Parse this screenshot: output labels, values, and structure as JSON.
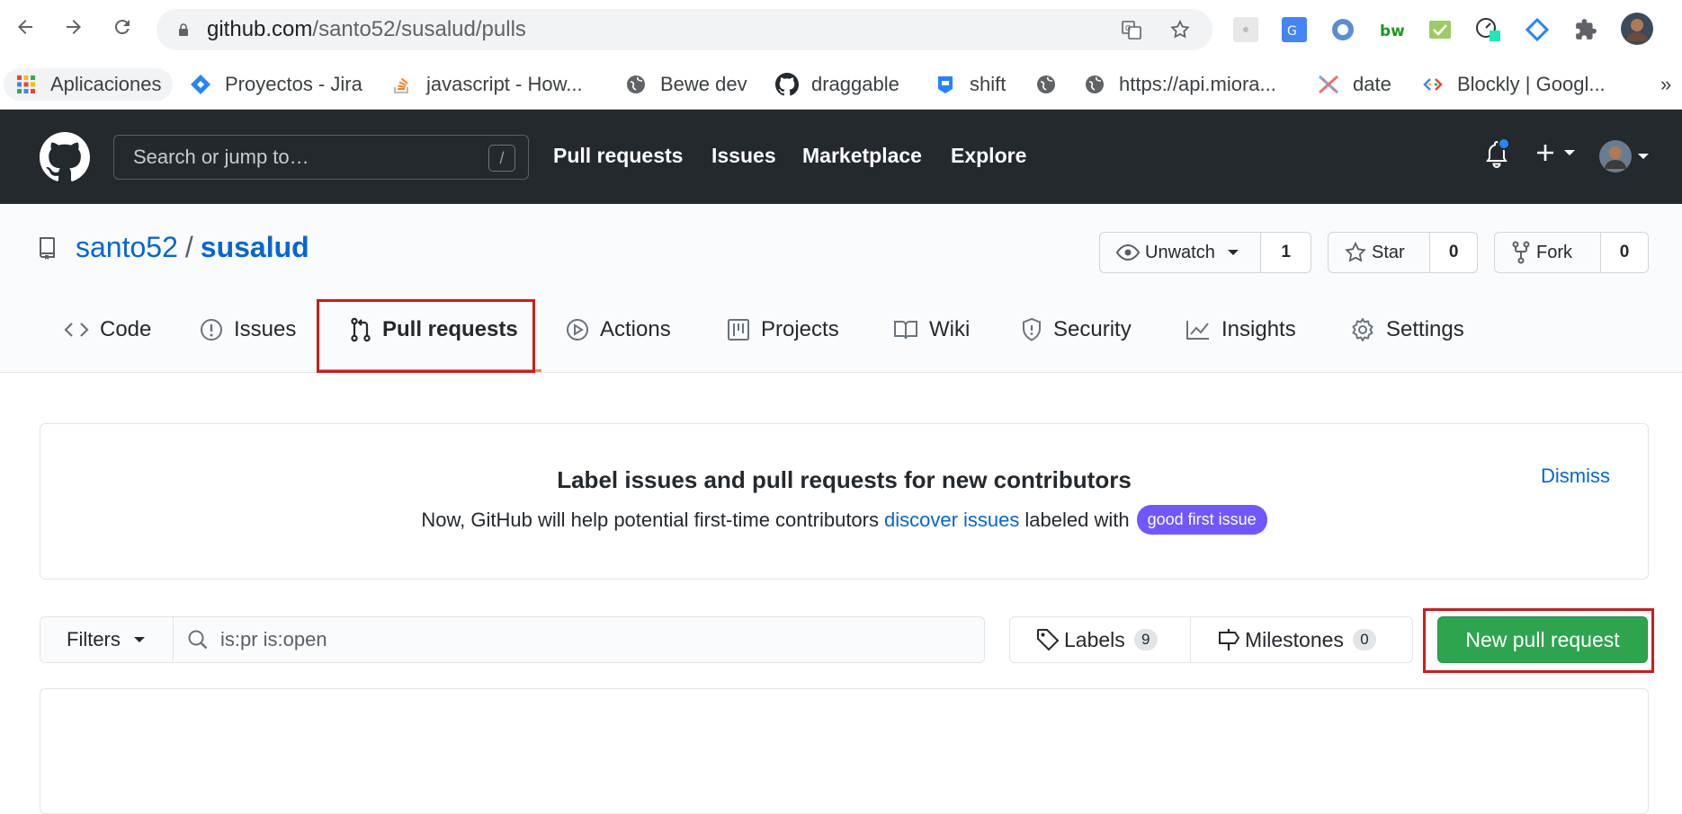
{
  "browser": {
    "url_host": "github.com",
    "url_path": "/santo52/susalud/pulls",
    "bookmarks": [
      {
        "label": "Aplicaciones",
        "icon": "apps-grid-icon"
      },
      {
        "label": "Proyectos - Jira",
        "icon": "jira-icon"
      },
      {
        "label": "javascript - How...",
        "icon": "stackoverflow-icon"
      },
      {
        "label": "Bewe dev",
        "icon": "globe-icon"
      },
      {
        "label": "draggable",
        "icon": "github-icon"
      },
      {
        "label": "shift",
        "icon": "shift-icon"
      },
      {
        "label": "",
        "icon": "globe-icon"
      },
      {
        "label": "https://api.miora...",
        "icon": "globe-icon"
      },
      {
        "label": "date",
        "icon": "date-icon"
      },
      {
        "label": "Blockly  |  Googl...",
        "icon": "blockly-icon"
      }
    ],
    "overflow": "»"
  },
  "gh_header": {
    "search_placeholder": "Search or jump to…",
    "search_shortcut": "/",
    "nav": [
      "Pull requests",
      "Issues",
      "Marketplace",
      "Explore"
    ]
  },
  "repo": {
    "owner": "santo52",
    "separator": "/",
    "name": "susalud",
    "unwatch_label": "Unwatch",
    "watch_count": "1",
    "star_label": "Star",
    "star_count": "0",
    "fork_label": "Fork",
    "fork_count": "0",
    "tabs": [
      {
        "label": "Code",
        "icon": "code-icon"
      },
      {
        "label": "Issues",
        "icon": "issue-opened-icon"
      },
      {
        "label": "Pull requests",
        "icon": "git-pull-request-icon",
        "active": true
      },
      {
        "label": "Actions",
        "icon": "play-icon"
      },
      {
        "label": "Projects",
        "icon": "project-icon"
      },
      {
        "label": "Wiki",
        "icon": "book-icon"
      },
      {
        "label": "Security",
        "icon": "shield-icon"
      },
      {
        "label": "Insights",
        "icon": "graph-icon"
      },
      {
        "label": "Settings",
        "icon": "gear-icon"
      }
    ]
  },
  "banner": {
    "title": "Label issues and pull requests for new contributors",
    "desc_before": "Now, GitHub will help potential first-time contributors",
    "desc_link": "discover issues",
    "desc_after": "labeled with",
    "label_name": "good first issue",
    "label_color": "#7057ff",
    "dismiss": "Dismiss"
  },
  "filters": {
    "filters_label": "Filters",
    "query": "is:pr is:open",
    "labels_label": "Labels",
    "labels_count": "9",
    "milestones_label": "Milestones",
    "milestones_count": "0",
    "new_pr_label": "New pull request"
  },
  "colors": {
    "accent_green": "#2ea44f",
    "link_blue": "#0366d6",
    "header_dark": "#24292e",
    "highlight_red": "#d11a1a"
  }
}
